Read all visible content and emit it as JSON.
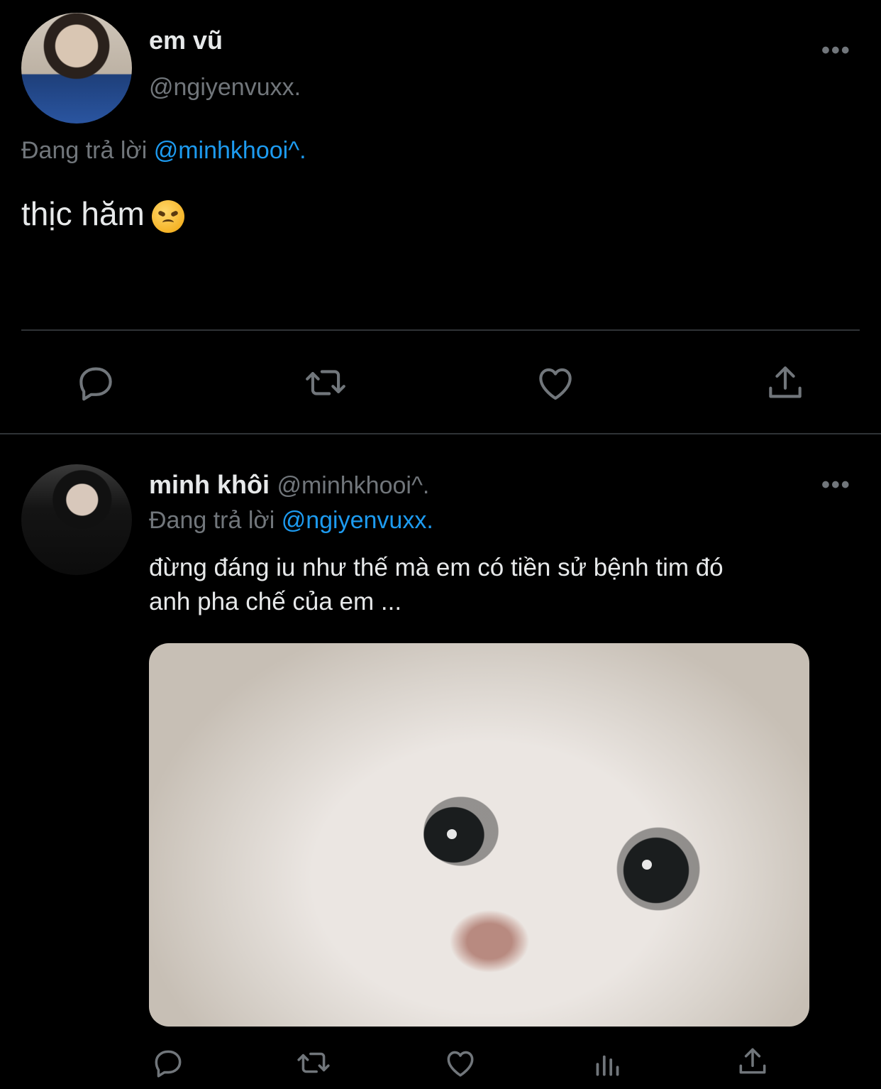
{
  "tweet1": {
    "name": "em vũ",
    "handle": "@ngiyenvuxx.",
    "more": "•••",
    "reply_prefix": "Đang trả lời",
    "reply_to": "@minhkhooi^.",
    "text": "thịc hăm",
    "actions": [
      "reply-icon",
      "retweet-icon",
      "like-icon",
      "share-icon"
    ]
  },
  "tweet2": {
    "name": "minh khôi",
    "handle": "@minhkhooi^.",
    "more": "•••",
    "reply_prefix": "Đang trả lời",
    "reply_to": "@ngiyenvuxx.",
    "text_line1": "đừng đáng iu như thế mà em có tiền sử bệnh tim đó",
    "text_line2": "anh pha chế của em ...",
    "actions": [
      "reply-icon",
      "retweet-icon",
      "like-icon",
      "analytics-icon",
      "share-icon"
    ]
  },
  "colors": {
    "background": "#000000",
    "text": "#e7e9ea",
    "secondary": "#71767b",
    "accent": "#1d9bf0",
    "divider": "#2f3336"
  }
}
